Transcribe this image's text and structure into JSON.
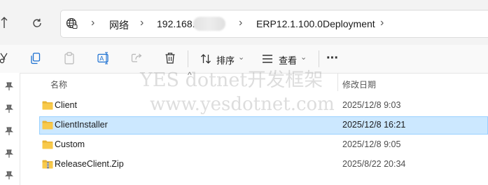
{
  "address_bar": {
    "crumbs": [
      "网络",
      "192.168.1",
      "ERP12.1.100.0Deployment"
    ]
  },
  "toolbar": {
    "sort_label": "排序",
    "view_label": "查看",
    "more_label": "···"
  },
  "file_list": {
    "columns": {
      "name": "名称",
      "modified": "修改日期"
    },
    "rows": [
      {
        "name": "Client",
        "modified": "2025/12/8 9:03",
        "icon": "folder-icon",
        "selected": false
      },
      {
        "name": "ClientInstaller",
        "modified": "2025/12/8 16:21",
        "icon": "folder-icon",
        "selected": true
      },
      {
        "name": "Custom",
        "modified": "2025/12/8 9:05",
        "icon": "folder-icon",
        "selected": false
      },
      {
        "name": "ReleaseClient.Zip",
        "modified": "2025/8/22 20:34",
        "icon": "zip-folder-icon",
        "selected": false
      }
    ]
  },
  "watermark": {
    "line1": "YES dotnet开发框架",
    "line2": "www.yesdotnet.com"
  },
  "colors": {
    "selection": "#cce8ff",
    "selection_border": "#99d1ff",
    "folder": "#f8c94a"
  }
}
